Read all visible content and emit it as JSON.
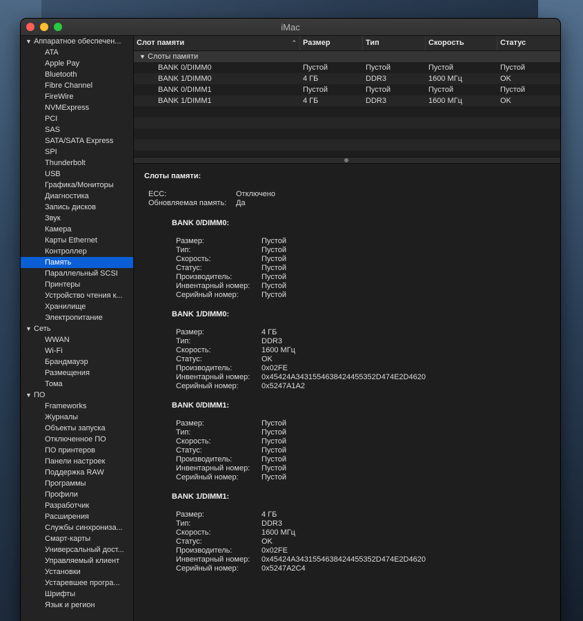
{
  "window": {
    "title": "iMac"
  },
  "sidebar": {
    "categories": [
      {
        "label": "Аппаратное обеспечен...",
        "items": [
          "ATA",
          "Apple Pay",
          "Bluetooth",
          "Fibre Channel",
          "FireWire",
          "NVMExpress",
          "PCI",
          "SAS",
          "SATA/SATA Express",
          "SPI",
          "Thunderbolt",
          "USB",
          "Графика/Мониторы",
          "Диагностика",
          "Запись дисков",
          "Звук",
          "Камера",
          "Карты Ethernet",
          "Контроллер",
          "Память",
          "Параллельный SCSI",
          "Принтеры",
          "Устройство чтения к...",
          "Хранилище",
          "Электропитание"
        ]
      },
      {
        "label": "Сеть",
        "items": [
          "WWAN",
          "Wi-Fi",
          "Брандмауэр",
          "Размещения",
          "Тома"
        ]
      },
      {
        "label": "ПО",
        "items": [
          "Frameworks",
          "Журналы",
          "Объекты запуска",
          "Отключенное ПО",
          "ПО принтеров",
          "Панели настроек",
          "Поддержка RAW",
          "Программы",
          "Профили",
          "Разработчик",
          "Расширения",
          "Службы синхрониза...",
          "Смарт-карты",
          "Универсальный дост...",
          "Управляемый клиент",
          "Установки",
          "Устаревшее програ...",
          "Шрифты",
          "Язык и регион"
        ]
      }
    ],
    "selected": "Память"
  },
  "table": {
    "headers": [
      "Слот памяти",
      "Размер",
      "Тип",
      "Скорость",
      "Статус"
    ],
    "group_label": "Слоты памяти",
    "rows": [
      [
        "BANK 0/DIMM0",
        "Пустой",
        "Пустой",
        "Пустой",
        "Пустой"
      ],
      [
        "BANK 1/DIMM0",
        "4 ГБ",
        "DDR3",
        "1600 МГц",
        "OK"
      ],
      [
        "BANK 0/DIMM1",
        "Пустой",
        "Пустой",
        "Пустой",
        "Пустой"
      ],
      [
        "BANK 1/DIMM1",
        "4 ГБ",
        "DDR3",
        "1600 МГц",
        "OK"
      ]
    ]
  },
  "detail": {
    "title": "Слоты памяти:",
    "summary": [
      {
        "key": "ECC:",
        "value": "Отключено"
      },
      {
        "key": "Обновляемая память:",
        "value": "Да"
      }
    ],
    "banks": [
      {
        "name": "BANK 0/DIMM0:",
        "fields": [
          [
            "Размер:",
            "Пустой"
          ],
          [
            "Тип:",
            "Пустой"
          ],
          [
            "Скорость:",
            "Пустой"
          ],
          [
            "Статус:",
            "Пустой"
          ],
          [
            "Производитель:",
            "Пустой"
          ],
          [
            "Инвентарный номер:",
            "Пустой"
          ],
          [
            "Серийный номер:",
            "Пустой"
          ]
        ]
      },
      {
        "name": "BANK 1/DIMM0:",
        "fields": [
          [
            "Размер:",
            "4 ГБ"
          ],
          [
            "Тип:",
            "DDR3"
          ],
          [
            "Скорость:",
            "1600 МГц"
          ],
          [
            "Статус:",
            "OK"
          ],
          [
            "Производитель:",
            "0x02FE"
          ],
          [
            "Инвентарный номер:",
            "0x45424A3431554638424455352D474E2D4620"
          ],
          [
            "Серийный номер:",
            "0x5247A1A2"
          ]
        ]
      },
      {
        "name": "BANK 0/DIMM1:",
        "fields": [
          [
            "Размер:",
            "Пустой"
          ],
          [
            "Тип:",
            "Пустой"
          ],
          [
            "Скорость:",
            "Пустой"
          ],
          [
            "Статус:",
            "Пустой"
          ],
          [
            "Производитель:",
            "Пустой"
          ],
          [
            "Инвентарный номер:",
            "Пустой"
          ],
          [
            "Серийный номер:",
            "Пустой"
          ]
        ]
      },
      {
        "name": "BANK 1/DIMM1:",
        "fields": [
          [
            "Размер:",
            "4 ГБ"
          ],
          [
            "Тип:",
            "DDR3"
          ],
          [
            "Скорость:",
            "1600 МГц"
          ],
          [
            "Статус:",
            "OK"
          ],
          [
            "Производитель:",
            "0x02FE"
          ],
          [
            "Инвентарный номер:",
            "0x45424A3431554638424455352D474E2D4620"
          ],
          [
            "Серийный номер:",
            "0x5247A2C4"
          ]
        ]
      }
    ]
  }
}
